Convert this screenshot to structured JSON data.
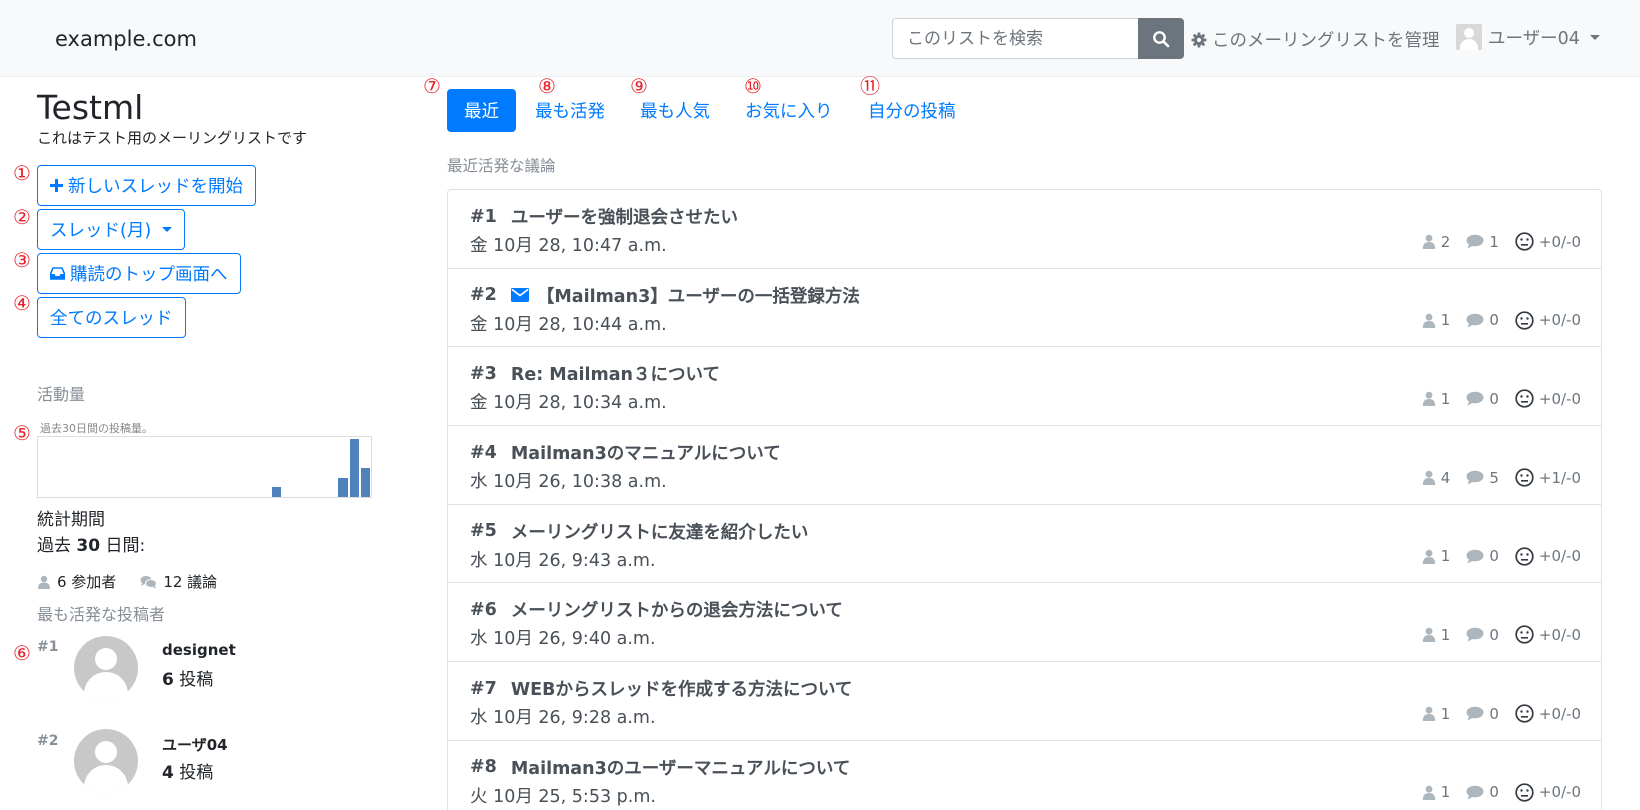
{
  "navbar": {
    "brand": "example.com",
    "search_placeholder": "このリストを検索",
    "manage_label": "このメーリングリストを管理",
    "user_label": "ユーザー04"
  },
  "markers": [
    "①",
    "②",
    "③",
    "④",
    "⑤",
    "⑥",
    "⑦",
    "⑧",
    "⑨",
    "⑩",
    "⑪"
  ],
  "sidebar": {
    "list_name": "Testml",
    "list_description": "これはテスト用のメーリングリストです",
    "new_thread_label": "新しいスレッドを開始",
    "thread_month_label": "スレッド(月)",
    "subscriptions_label": "購読のトップ画面へ",
    "all_threads_label": "全てのスレッド",
    "activity_heading": "活動量",
    "chart_caption": "過去30日間の投稿量。",
    "stats_period_label": "統計期間",
    "stats_days_prefix": "過去",
    "stats_days_value": "30",
    "stats_days_suffix": "日間:",
    "participants_text": "6 参加者",
    "discussions_text": "12 議論",
    "top_posters_heading": "最も活発な投稿者",
    "top_posters": [
      {
        "rank": "#1",
        "name": "designet",
        "count": "6",
        "unit": "投稿"
      },
      {
        "rank": "#2",
        "name": "ユーザ04",
        "count": "4",
        "unit": "投稿"
      }
    ]
  },
  "chart_data": {
    "type": "bar",
    "title": "",
    "caption": "過去30日間の投稿量。",
    "categories": [
      "1",
      "2",
      "3",
      "4",
      "5",
      "6",
      "7",
      "8",
      "9",
      "10",
      "11",
      "12",
      "13",
      "14",
      "15",
      "16",
      "17",
      "18",
      "19",
      "20",
      "21",
      "22",
      "23",
      "24",
      "25",
      "26",
      "27",
      "28",
      "29",
      "30"
    ],
    "values": [
      0,
      0,
      0,
      0,
      0,
      0,
      0,
      0,
      0,
      0,
      0,
      0,
      0,
      0,
      0,
      0,
      0,
      0,
      0,
      0,
      0,
      1,
      0,
      0,
      0,
      0,
      0,
      2,
      6,
      3
    ],
    "ylim": [
      0,
      6
    ],
    "color": "#4f81bd",
    "grid": false
  },
  "tabs": [
    {
      "label": "最近",
      "active": true
    },
    {
      "label": "最も活発",
      "active": false
    },
    {
      "label": "最も人気",
      "active": false
    },
    {
      "label": "お気に入り",
      "active": false
    },
    {
      "label": "自分の投稿",
      "active": false
    }
  ],
  "section_heading": "最近活発な議論",
  "threads": [
    {
      "num": "#1",
      "title": "ユーザーを強制退会させたい",
      "date": "金 10月 28, 10:47 a.m.",
      "participants": "2",
      "replies": "1",
      "votes": "+0/-0",
      "unread": false
    },
    {
      "num": "#2",
      "title": "【Mailman3】ユーザーの一括登録方法",
      "date": "金 10月 28, 10:44 a.m.",
      "participants": "1",
      "replies": "0",
      "votes": "+0/-0",
      "unread": true
    },
    {
      "num": "#3",
      "title": "Re: Mailman３について",
      "date": "金 10月 28, 10:34 a.m.",
      "participants": "1",
      "replies": "0",
      "votes": "+0/-0",
      "unread": false
    },
    {
      "num": "#4",
      "title": "Mailman3のマニュアルについて",
      "date": "水 10月 26, 10:38 a.m.",
      "participants": "4",
      "replies": "5",
      "votes": "+1/-0",
      "unread": false
    },
    {
      "num": "#5",
      "title": "メーリングリストに友達を紹介したい",
      "date": "水 10月 26, 9:43 a.m.",
      "participants": "1",
      "replies": "0",
      "votes": "+0/-0",
      "unread": false
    },
    {
      "num": "#6",
      "title": "メーリングリストからの退会方法について",
      "date": "水 10月 26, 9:40 a.m.",
      "participants": "1",
      "replies": "0",
      "votes": "+0/-0",
      "unread": false
    },
    {
      "num": "#7",
      "title": "WEBからスレッドを作成する方法について",
      "date": "水 10月 26, 9:28 a.m.",
      "participants": "1",
      "replies": "0",
      "votes": "+0/-0",
      "unread": false
    },
    {
      "num": "#8",
      "title": "Mailman3のユーザーマニュアルについて",
      "date": "火 10月 25, 5:53 p.m.",
      "participants": "1",
      "replies": "0",
      "votes": "+0/-0",
      "unread": false
    }
  ]
}
